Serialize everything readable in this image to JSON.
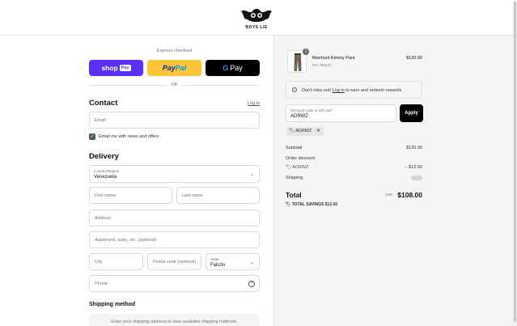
{
  "brand": {
    "logo_text": "BOYS LIE"
  },
  "express": {
    "title": "Express checkout",
    "shop_label": "shop",
    "shop_pay_tag": "Pay",
    "paypal_pay": "Pay",
    "paypal_pal": "Pal",
    "gpay_g": "G",
    "gpay_label": "Pay",
    "or": "OR"
  },
  "contact": {
    "title": "Contact",
    "login": "Log in",
    "email_placeholder": "Email",
    "newsletter_label": "Email me with news and offers",
    "newsletter_checked": true
  },
  "delivery": {
    "title": "Delivery",
    "country_label": "Country/Region",
    "country_value": "Venezuela",
    "first_name": "First name",
    "last_name": "Last name",
    "address": "Address",
    "apartment": "Apartment, suite, etc. (optional)",
    "city": "City",
    "postal": "Postal code (optional)",
    "state_label": "State",
    "state_value": "Falcón",
    "phone": "Phone"
  },
  "shipping_method": {
    "title": "Shipping method",
    "message": "Enter your shipping address to view available shipping methods."
  },
  "order": {
    "item": {
      "name": "Manhunt Kimmy Pant",
      "variant": "XS / MULTI",
      "price": "$120.00",
      "quantity": "1"
    },
    "rewards": {
      "prefix": "Don't miss out! ",
      "link": "Log in",
      "suffix": " to earn and redeem rewards"
    },
    "discount_label": "Discount code or gift card",
    "discount_value": "ADRWZ",
    "apply": "Apply",
    "chip": "ADRWZ",
    "subtotal_label": "Subtotal",
    "subtotal_value": "$120.00",
    "order_discount_label": "Order discount",
    "discount_code": "ADRWZ",
    "discount_amount": "− $12.00",
    "shipping_label": "Shipping",
    "total_label": "Total",
    "total_currency": "USD",
    "total_value": "$108.00",
    "savings_label": "TOTAL SAVINGS",
    "savings_value": "$12.00"
  },
  "colors": {
    "shop_pay": "#5a31f4",
    "paypal": "#ffc439",
    "gpay": "#000000",
    "apply": "#000000",
    "checkbox": "#4a5d5a"
  }
}
